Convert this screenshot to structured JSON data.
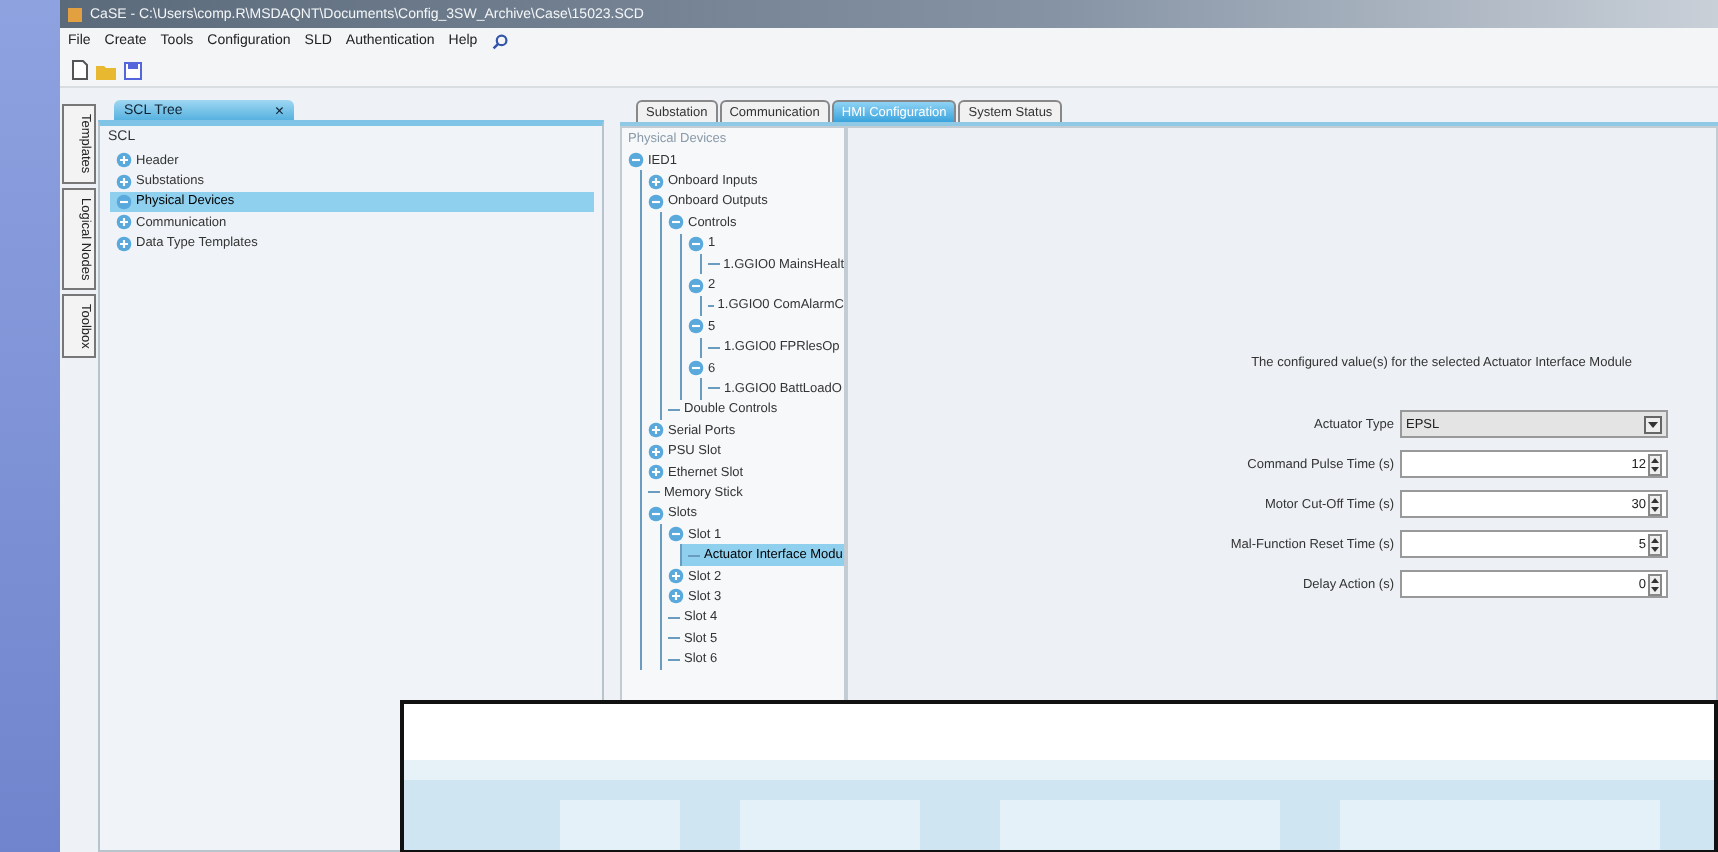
{
  "window": {
    "title": "CaSE - C:\\Users\\comp.R\\MSDAQNT\\Documents\\Config_3SW_Archive\\Case\\15023.SCD"
  },
  "menu": [
    "File",
    "Create",
    "Tools",
    "Configuration",
    "SLD",
    "Authentication",
    "Help"
  ],
  "side_tabs": [
    {
      "label": "Templates",
      "selected": false
    },
    {
      "label": "Logical Nodes",
      "selected": false
    },
    {
      "label": "Toolbox",
      "selected": false
    }
  ],
  "scl_panel": {
    "tab": "SCL Tree",
    "close": "×",
    "root": "SCL",
    "items": [
      {
        "label": "Header",
        "expanded": false,
        "selected": false
      },
      {
        "label": "Substations",
        "expanded": false,
        "selected": false
      },
      {
        "label": "Physical Devices",
        "expanded": true,
        "selected": true
      },
      {
        "label": "Communication",
        "expanded": false,
        "selected": false
      },
      {
        "label": "Data Type Templates",
        "expanded": false,
        "selected": false
      }
    ]
  },
  "tabs": [
    {
      "label": "Substation",
      "selected": false
    },
    {
      "label": "Communication",
      "selected": false
    },
    {
      "label": "HMI Configuration",
      "selected": true
    },
    {
      "label": "System Status",
      "selected": false
    }
  ],
  "device_tree": {
    "heading": "Physical Devices",
    "items": [
      {
        "label": "IED1",
        "expanded": true,
        "selected": false,
        "children": [
          {
            "label": "Onboard Inputs",
            "expanded": false,
            "selected": false
          },
          {
            "label": "Onboard Outputs",
            "expanded": true,
            "selected": false,
            "children": [
              {
                "label": "Controls",
                "expanded": true,
                "selected": false,
                "children": [
                  {
                    "label": "1",
                    "expanded": true,
                    "selected": false,
                    "children": [
                      {
                        "label": "1.GGIO0 MainsHealt",
                        "selected": false
                      }
                    ]
                  },
                  {
                    "label": "2",
                    "expanded": true,
                    "selected": false,
                    "children": [
                      {
                        "label": "1.GGIO0 ComAlarmC",
                        "selected": false
                      }
                    ]
                  },
                  {
                    "label": "5",
                    "expanded": true,
                    "selected": false,
                    "children": [
                      {
                        "label": "1.GGIO0 FPRlesOp",
                        "selected": false
                      }
                    ]
                  },
                  {
                    "label": "6",
                    "expanded": true,
                    "selected": false,
                    "children": [
                      {
                        "label": "1.GGIO0 BattLoadO",
                        "selected": false
                      }
                    ]
                  }
                ]
              },
              {
                "label": "Double Controls",
                "selected": false
              }
            ]
          },
          {
            "label": "Serial Ports",
            "expanded": false,
            "selected": false
          },
          {
            "label": "PSU Slot",
            "expanded": false,
            "selected": false
          },
          {
            "label": "Ethernet Slot",
            "expanded": false,
            "selected": false
          },
          {
            "label": "Memory Stick",
            "selected": false
          },
          {
            "label": "Slots",
            "expanded": true,
            "selected": false,
            "children": [
              {
                "label": "Slot 1",
                "expanded": true,
                "selected": false,
                "children": [
                  {
                    "label": "Actuator Interface Modu",
                    "selected": true
                  }
                ]
              },
              {
                "label": "Slot 2",
                "expanded": false,
                "selected": false
              },
              {
                "label": "Slot 3",
                "expanded": false,
                "selected": false
              },
              {
                "label": "Slot 4",
                "selected": false
              },
              {
                "label": "Slot 5",
                "selected": false
              },
              {
                "label": "Slot 6",
                "selected": false
              }
            ]
          }
        ]
      }
    ]
  },
  "form": {
    "heading": "The configured value(s) for the selected Actuator Interface Module",
    "fields": [
      {
        "kind": "select",
        "label": "Actuator Type",
        "value": "EPSL"
      },
      {
        "kind": "spinner",
        "label": "Command Pulse Time (s)",
        "value": "12"
      },
      {
        "kind": "spinner",
        "label": "Motor Cut-Off Time (s)",
        "value": "30"
      },
      {
        "kind": "spinner",
        "label": "Mal-Function Reset Time (s)",
        "value": "5"
      },
      {
        "kind": "spinner",
        "label": "Delay Action (s)",
        "value": "0"
      }
    ]
  }
}
